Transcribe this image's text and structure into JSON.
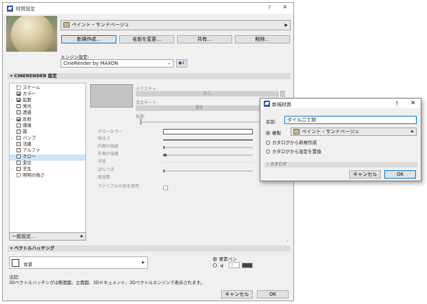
{
  "main_window": {
    "title": "材質設定",
    "help": "?",
    "close": "✕",
    "material_name": "ペイント・サンドベージュ",
    "buttons": [
      "新規作成...",
      "名前を変更...",
      "共有...",
      "削除..."
    ],
    "engine_label": "エンジン設定:",
    "engine_value": "CineRender by MAXON",
    "engine_badge": "1",
    "section_cinerender": "CINERENDER 設定",
    "channels": [
      {
        "label": "スケール",
        "checked": null,
        "expand": false,
        "selected": false
      },
      {
        "label": "カラー",
        "checked": true,
        "expand": false,
        "selected": false
      },
      {
        "label": "拡散",
        "checked": true,
        "expand": true,
        "selected": false
      },
      {
        "label": "発光",
        "checked": false,
        "expand": false,
        "selected": false
      },
      {
        "label": "透過",
        "checked": false,
        "expand": false,
        "selected": false
      },
      {
        "label": "反射",
        "checked": true,
        "expand": true,
        "selected": false
      },
      {
        "label": "環境",
        "checked": false,
        "expand": false,
        "selected": false
      },
      {
        "label": "霧",
        "checked": false,
        "expand": false,
        "selected": false
      },
      {
        "label": "バンプ",
        "checked": false,
        "expand": true,
        "selected": false
      },
      {
        "label": "法線",
        "checked": false,
        "expand": false,
        "selected": false
      },
      {
        "label": "アルファ",
        "checked": false,
        "expand": false,
        "selected": false
      },
      {
        "label": "グロー",
        "checked": false,
        "expand": false,
        "selected": true
      },
      {
        "label": "変位",
        "checked": false,
        "expand": false,
        "selected": false
      },
      {
        "label": "芝生",
        "checked": false,
        "expand": true,
        "selected": false
      },
      {
        "label": "照明の強さ",
        "checked": null,
        "expand": false,
        "selected": false
      }
    ],
    "texture_label": "テクスチャ:",
    "texture_value": "なし",
    "blend_label": "混合モード:",
    "blend_value": "通常",
    "strength_label": "強度:",
    "params": [
      "グローカラー",
      "明るさ",
      "内側の強度",
      "外側の強度",
      "半径",
      "ばらつき",
      "周波数",
      "マテリアルの色を使用"
    ],
    "general_settings": "一般設定...",
    "section_vector": "ベクトルハッチング",
    "hatch_value": "背景",
    "pen_radio": "要素ペン",
    "pen_number": "1",
    "note_title": "注記:",
    "note_text": "3Dベクトルハッチングは断面図、立面図、3Dドキュメント、3Dベクトルエンジンで表示されます。",
    "cancel": "キャンセル",
    "ok": "OK"
  },
  "dialog": {
    "title": "新規材質",
    "help": "?",
    "close": "✕",
    "name_label": "名前:",
    "name_value": "タイル二丁掛",
    "options": [
      {
        "label": "複製",
        "selected": true
      },
      {
        "label": "カタログから新規作成",
        "selected": false
      },
      {
        "label": "カタログから設定を置換",
        "selected": false
      }
    ],
    "duplicate_material": "ペイント・サンドベージュ",
    "catalog": "カタログ",
    "cancel": "キャンセル",
    "ok": "OK"
  }
}
